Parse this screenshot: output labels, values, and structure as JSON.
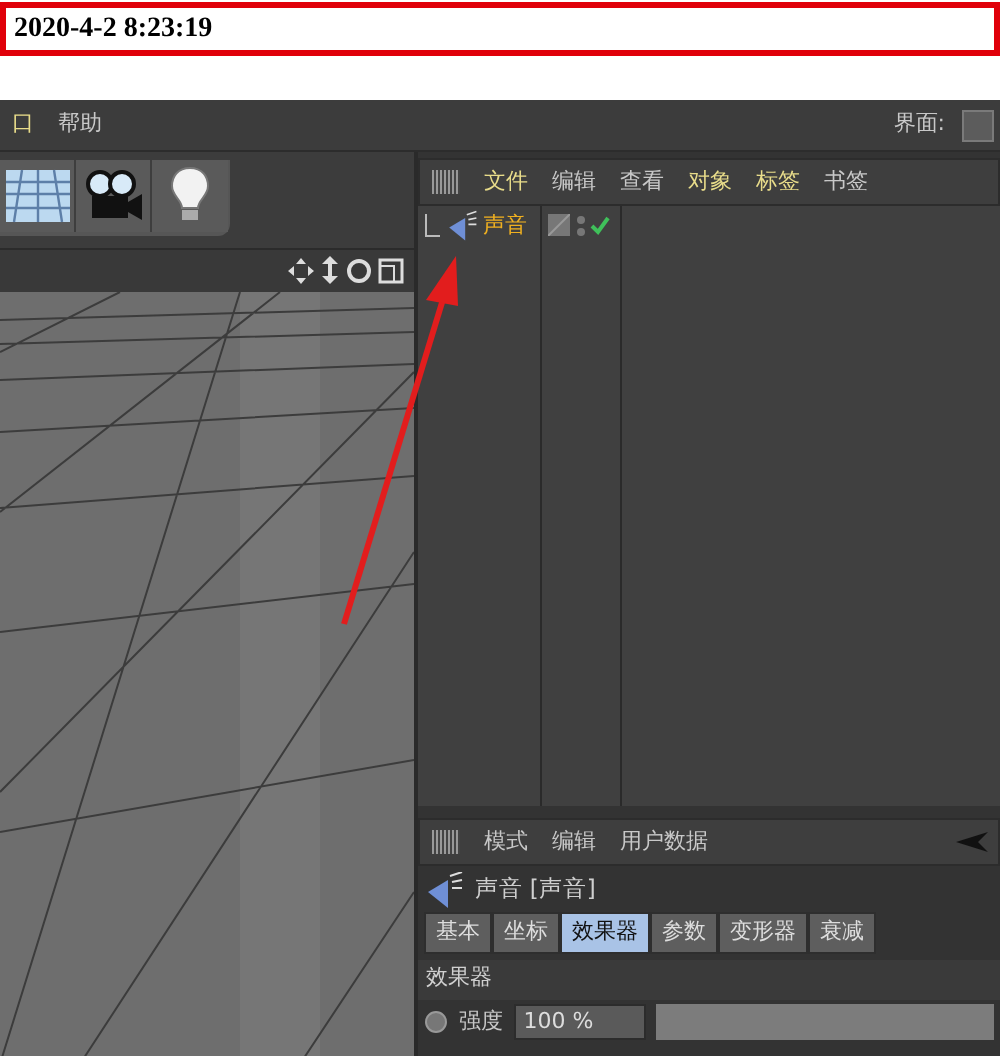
{
  "timestamp": "2020-4-2 8:23:19",
  "menu_bar": {
    "items": [
      {
        "label": "口",
        "highlighted": true
      },
      {
        "label": "帮助",
        "highlighted": false
      }
    ],
    "layout_label": "界面:"
  },
  "object_manager": {
    "menu": [
      {
        "label": "文件",
        "highlighted": true
      },
      {
        "label": "编辑",
        "highlighted": false
      },
      {
        "label": "查看",
        "highlighted": false
      },
      {
        "label": "对象",
        "highlighted": true
      },
      {
        "label": "标签",
        "highlighted": true
      },
      {
        "label": "书签",
        "highlighted": false
      }
    ],
    "objects": [
      {
        "name": "声音",
        "selected": true,
        "enabled": true
      }
    ]
  },
  "attribute_manager": {
    "menu": [
      "模式",
      "编辑",
      "用户数据"
    ],
    "object_title": "声音 [声音]",
    "tabs": [
      {
        "label": "基本",
        "selected": false
      },
      {
        "label": "坐标",
        "selected": false
      },
      {
        "label": "效果器",
        "selected": true
      },
      {
        "label": "参数",
        "selected": false
      },
      {
        "label": "变形器",
        "selected": false
      },
      {
        "label": "衰减",
        "selected": false
      }
    ],
    "section": "效果器",
    "fields": [
      {
        "label": "强度",
        "value": "100 %"
      }
    ]
  }
}
